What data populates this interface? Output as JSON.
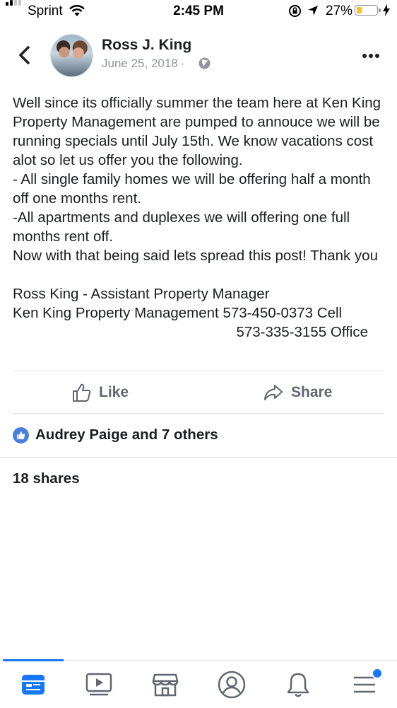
{
  "status_bar": {
    "carrier": "Sprint",
    "time": "2:45 PM",
    "battery_pct": "27%",
    "battery_level": 0.27
  },
  "post": {
    "author": "Ross J. King",
    "date": "June 25, 2018",
    "separator": "·",
    "paragraphs": [
      "Well since its officially summer the team here at Ken King Property Management are pumped to annouce we will be running specials until July 15th. We know vacations cost alot so let us offer you the following.",
      "- All single family homes we will be offering half a month off one months rent.",
      "-All apartments and duplexes we will offering one full months rent off.",
      "Now with that being said lets spread this post! Thank you"
    ],
    "signature_line1": "Ross King - Assistant Property Manager",
    "signature_line2": "Ken King Property Management 573-450-0373 Cell",
    "signature_line3": "573-335-3155 Office"
  },
  "actions": {
    "like_label": "Like",
    "share_label": "Share"
  },
  "reactions_text": "Audrey Paige and 7 others",
  "shares_text": "18 shares",
  "tabs": [
    "news-feed",
    "watch",
    "marketplace",
    "profile",
    "notifications",
    "menu"
  ],
  "colors": {
    "accent": "#1877f2",
    "like_badge": "#4a7ed9",
    "secondary_text": "#90949c",
    "action_text": "#606770",
    "battery_fill": "#f5c422"
  }
}
